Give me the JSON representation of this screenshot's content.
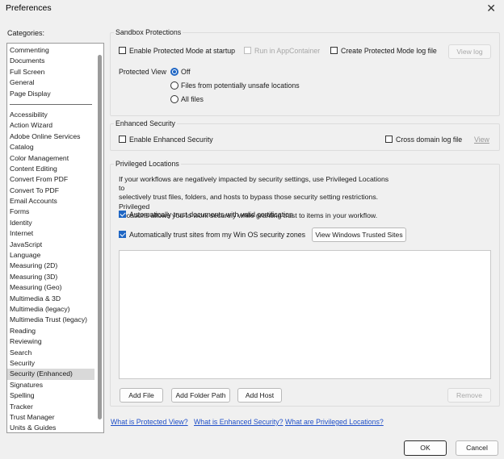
{
  "window": {
    "title": "Preferences",
    "close_glyph": "✕"
  },
  "sidebar": {
    "label": "Categories:",
    "top_items": [
      "Commenting",
      "Documents",
      "Full Screen",
      "General",
      "Page Display"
    ],
    "items": [
      "Accessibility",
      "Action Wizard",
      "Adobe Online Services",
      "Catalog",
      "Color Management",
      "Content Editing",
      "Convert From PDF",
      "Convert To PDF",
      "Email Accounts",
      "Forms",
      "Identity",
      "Internet",
      "JavaScript",
      "Language",
      "Measuring (2D)",
      "Measuring (3D)",
      "Measuring (Geo)",
      "Multimedia & 3D",
      "Multimedia (legacy)",
      "Multimedia Trust (legacy)",
      "Reading",
      "Reviewing",
      "Search",
      "Security",
      "Security (Enhanced)",
      "Signatures",
      "Spelling",
      "Tracker",
      "Trust Manager",
      "Units & Guides"
    ],
    "selected": "Security (Enhanced)"
  },
  "sandbox": {
    "title": "Sandbox Protections",
    "enable_protected_mode": "Enable Protected Mode at startup",
    "run_in_appcontainer": "Run in AppContainer",
    "create_log": "Create Protected Mode log file",
    "view_log": "View log",
    "protected_view_label": "Protected View",
    "options": [
      "Off",
      "Files from potentially unsafe locations",
      "All files"
    ],
    "selected_option": "Off"
  },
  "enhanced": {
    "title": "Enhanced Security",
    "enable": "Enable Enhanced Security",
    "cross_domain": "Cross domain log file",
    "view": "View"
  },
  "privileged": {
    "title": "Privileged Locations",
    "description_lines": [
      "If your workflows are negatively impacted by security settings, use Privileged Locations to",
      "selectively trust files, folders, and hosts to bypass those security setting restrictions. Privileged",
      "Locations allows you to work securely while granting trust to items in your workflow."
    ],
    "trust_certified": "Automatically trust documents with valid certification",
    "trust_sites": "Automatically trust sites from my Win OS security zones",
    "view_trusted_sites": "View Windows Trusted Sites",
    "add_file": "Add File",
    "add_folder": "Add Folder Path",
    "add_host": "Add Host",
    "remove": "Remove"
  },
  "links": {
    "protected_view": "What is Protected View?",
    "enhanced_security": "What is Enhanced Security?",
    "privileged_locations": "What are Privileged Locations?"
  },
  "footer": {
    "ok": "OK",
    "cancel": "Cancel"
  },
  "colors": {
    "accent": "#1f66c4",
    "link": "#1f4fc8",
    "background": "#f0f0f0"
  }
}
